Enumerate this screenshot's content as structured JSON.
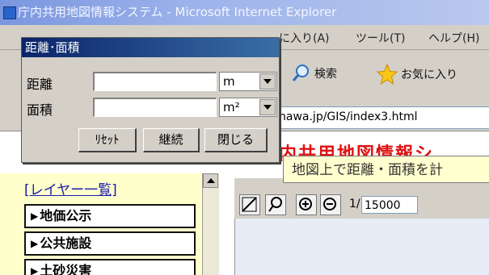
{
  "window": {
    "title": "庁内共用地図情報システム - Microsoft Internet Explorer"
  },
  "menu": {
    "favorites": "に入り(A)",
    "tools": "ツール(T)",
    "help": "ヘルプ(H)"
  },
  "toolbar": {
    "search": "検索",
    "favorites": "お気に入り"
  },
  "address": {
    "url": "nawa.jp/GIS/index3.html"
  },
  "page": {
    "header_partial": "内共用地図情報シ",
    "tooltip": "地図上で距離・面積を計",
    "layer_list_link": "[レイヤー一覧]",
    "layers": [
      "地価公示",
      "公共施設",
      "土砂災害"
    ],
    "scale_prefix": "1/",
    "scale_value": "15000"
  },
  "dialog": {
    "title": "距離･面積",
    "distance_label": "距離",
    "area_label": "面積",
    "distance_value": "",
    "area_value": "",
    "distance_unit": "m",
    "area_unit": "m²",
    "reset": "ﾘｾｯﾄ",
    "continue": "継続",
    "close": "閉じる"
  },
  "colors": {
    "dialog_title": "#0a246a",
    "tooltip_bg": "#ffffcf",
    "panel_bg": "#ffffcc",
    "header_text": "#e01010"
  }
}
